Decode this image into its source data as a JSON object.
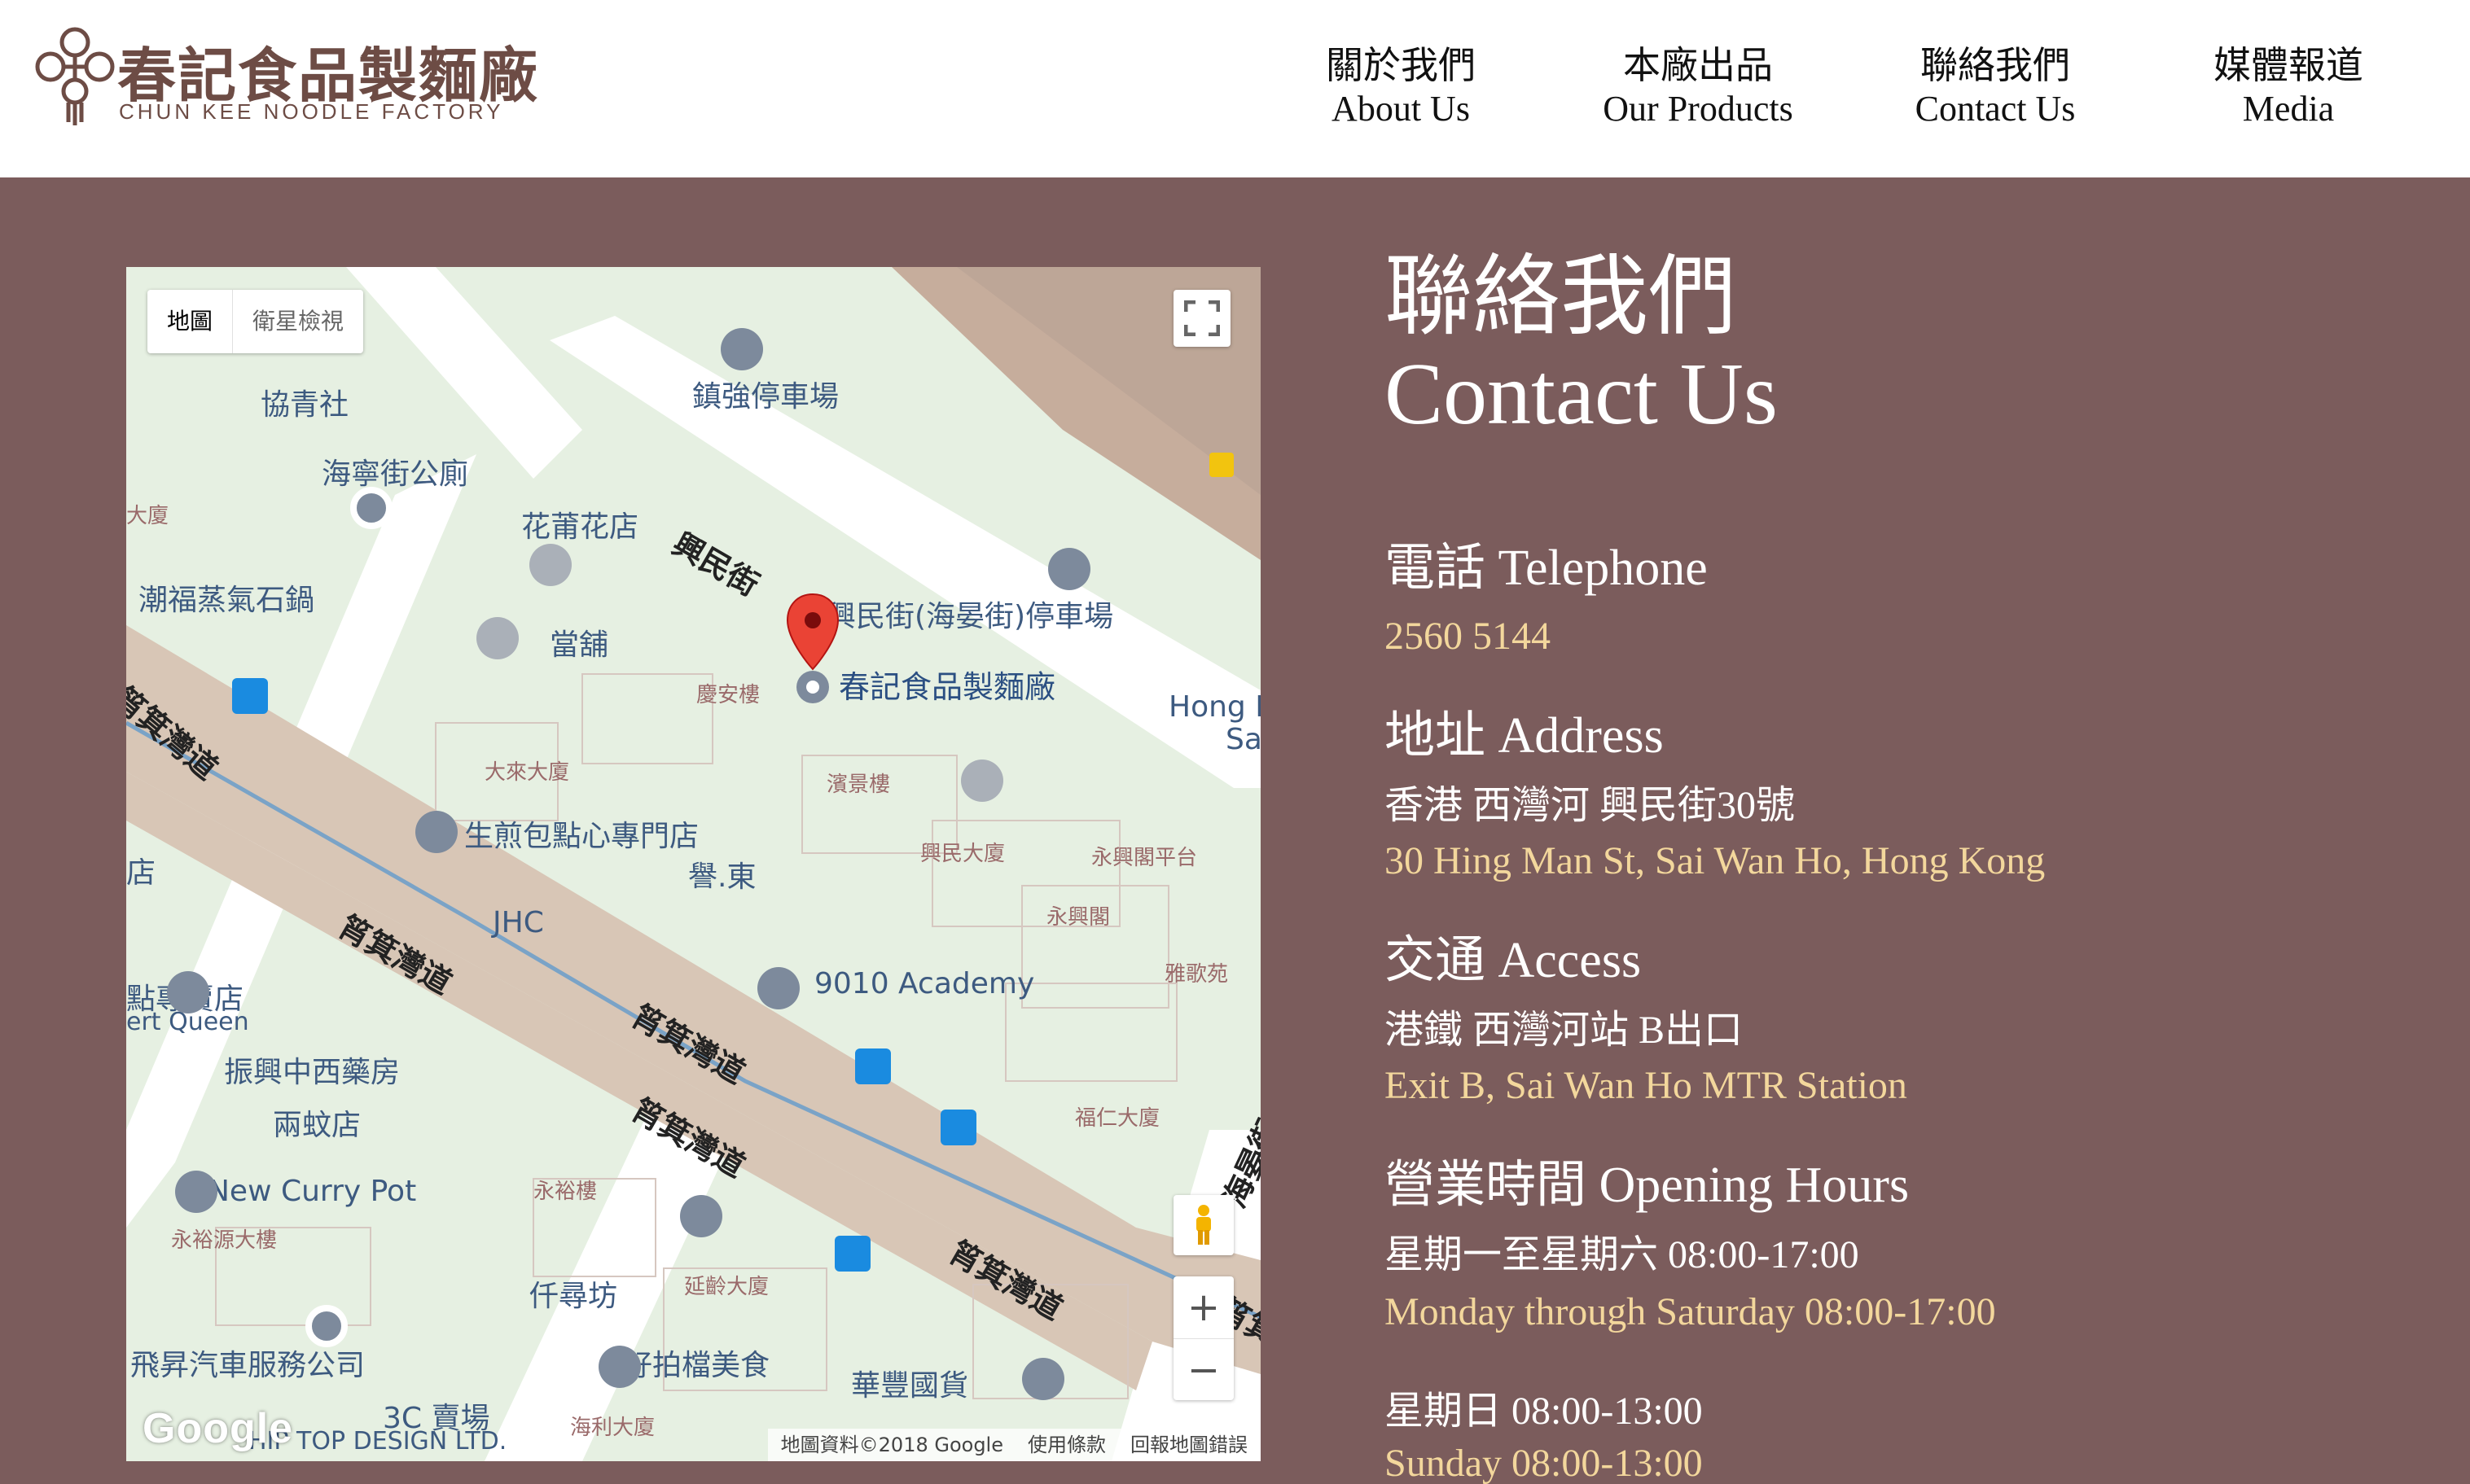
{
  "header": {
    "logo_zh": "春記食品製麵廠",
    "logo_en": "CHUN KEE NOODLE FACTORY",
    "nav": [
      {
        "zh": "關於我們",
        "en": "About Us"
      },
      {
        "zh": "本廠出品",
        "en": "Our Products"
      },
      {
        "zh": "聯絡我們",
        "en": "Contact Us"
      },
      {
        "zh": "媒體報道",
        "en": "Media"
      }
    ]
  },
  "map": {
    "type_map": "地圖",
    "type_satellite": "衛星檢視",
    "zoom_in": "+",
    "zoom_out": "−",
    "google": "Google",
    "attribution": "地圖資料©2018 Google",
    "terms": "使用條款",
    "report": "回報地圖錯誤",
    "marker_label": "春記食品製麵廠",
    "labels": {
      "hip_tsing": "協青社",
      "hoi_ning_toilet": "海寧街公廁",
      "chun_keung_parking": "鎮強停車場",
      "hing_man_st": "興民街",
      "flower_shop": "花莆花店",
      "chiu_fuk": "潮福蒸氣石鍋",
      "pawn": "當舖",
      "hing_man_parking": "興民街(海晏街)停車場",
      "hing_on": "慶安樓",
      "hong_k": "Hong K",
      "sa": "Sa",
      "kei_kei_road_1": "筲箕灣道",
      "tai_lai": "大來大廈",
      "bun_shop": "生煎包點心專門店",
      "tsun_king": "濱景樓",
      "hing_man_bldg": "興民大廈",
      "wing_hing_platform": "永興閣平台",
      "yi_tung": "譽.東",
      "wing_hing": "永興閣",
      "jhc": "JHC",
      "kei_kei_road_2": "筲箕灣道",
      "kei_kei_road_3": "筲箕灣道",
      "store": "店",
      "dessert_shop": "點專賣店",
      "dessert_queen": "ert Queen",
      "academy": "9010 Academy",
      "nga_ko": "雅歌苑",
      "pharmacy": "振興中西藥房",
      "kei_kei_road_4": "筲箕灣道",
      "two_mosquito": "兩蚊店",
      "fuk_yan": "福仁大廈",
      "curry_pot": "New Curry Pot",
      "wing_yue_source": "永裕源大樓",
      "wing_yu": "永裕樓",
      "kei_kei_road_5": "筲箕灣道",
      "hoi_yan_st": "海晏街",
      "kan_sun": "仟尋坊",
      "yin_ling": "延齡大廈",
      "fei_sing": "飛昇汽車服務公司",
      "good_stall": "好拍檔美食",
      "wah_fung": "華豐國貨",
      "three_c": "3C 賣場",
      "hip_top": "HIP TOP DESIGN LTD.",
      "hoi_lei": "海利大廈",
      "kei_kei_road_6": "筲箕",
      "dai_ha": "大廈"
    }
  },
  "contact": {
    "title_zh": "聯絡我們",
    "title_en": "Contact Us",
    "telephone": {
      "heading": "電話 Telephone",
      "value": "2560 5144"
    },
    "address": {
      "heading": "地址 Address",
      "zh": "香港 西灣河 興民街30號",
      "en": "30 Hing Man St, Sai Wan Ho, Hong Kong"
    },
    "access": {
      "heading": "交通 Access",
      "zh": "港鐵 西灣河站 B出口",
      "en": "Exit B, Sai Wan Ho MTR Station"
    },
    "hours": {
      "heading": "營業時間 Opening Hours",
      "weekday_zh": "星期一至星期六 08:00-17:00",
      "weekday_en": "Monday through Saturday 08:00-17:00",
      "sunday_zh": "星期日 08:00-13:00",
      "sunday_en": "Sunday 08:00-13:00"
    }
  }
}
